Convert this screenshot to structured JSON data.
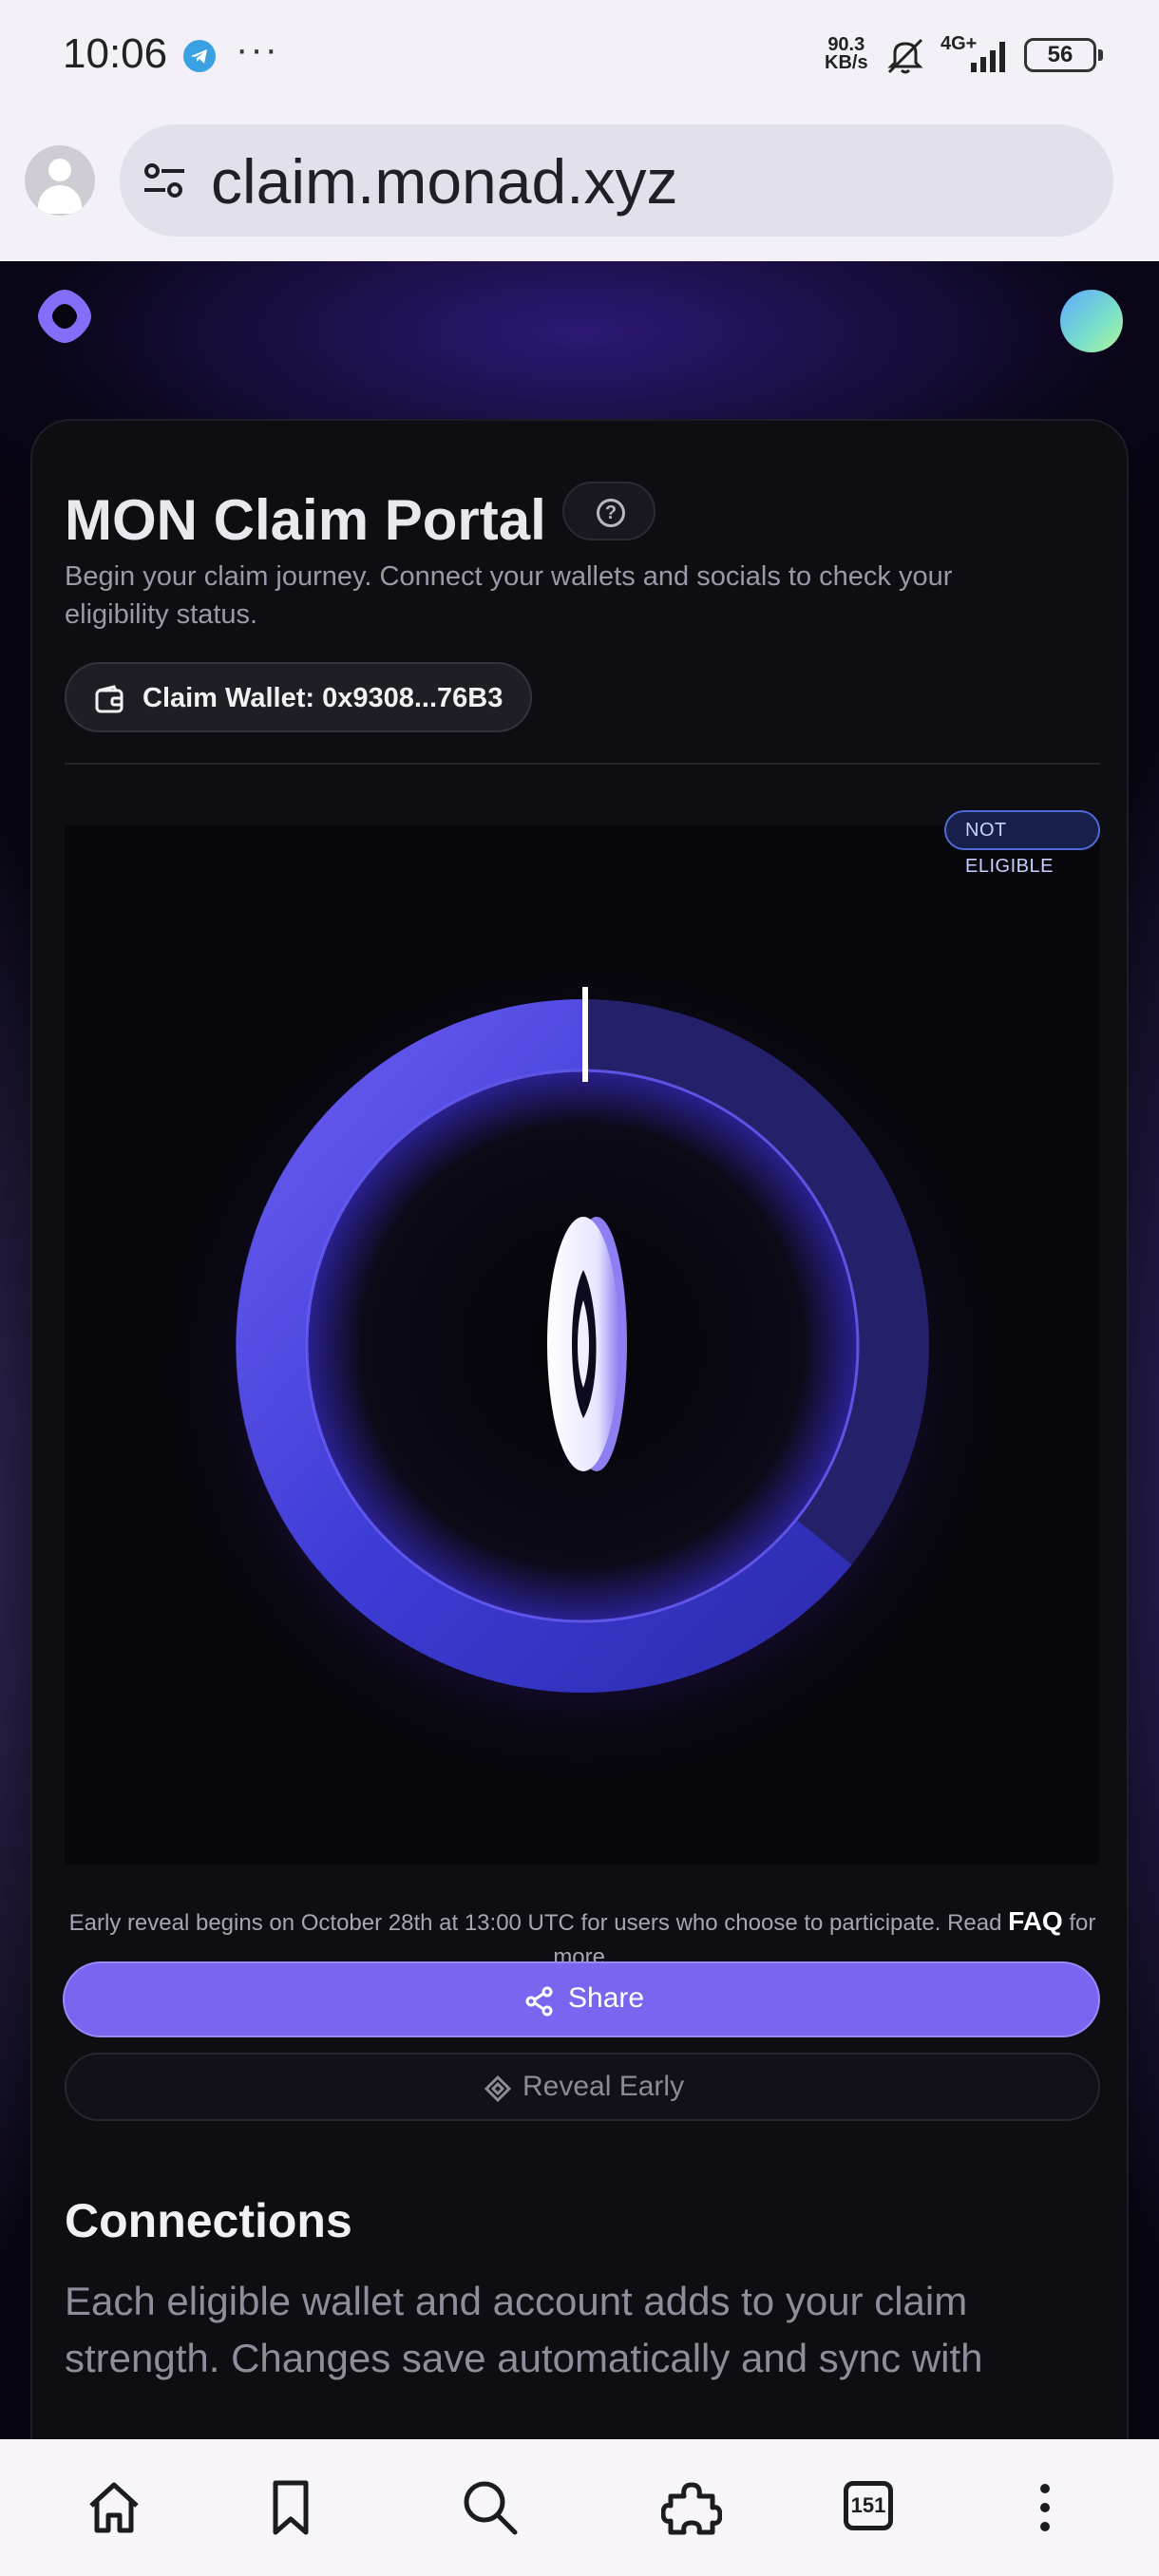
{
  "status_bar": {
    "time": "10:06",
    "dots": "···",
    "net_speed_value": "90.3",
    "net_speed_unit": "KB/s",
    "network_type": "4G+",
    "battery": "56",
    "icons": [
      "telegram-icon",
      "mute-icon",
      "signal-icon",
      "battery-icon"
    ]
  },
  "browser": {
    "url": "claim.monad.xyz",
    "tab_count": "151",
    "nav_icons": [
      "home-icon",
      "bookmark-icon",
      "search-icon",
      "extensions-icon",
      "tabs-icon",
      "more-icon"
    ]
  },
  "page": {
    "title": "MON Claim Portal",
    "help_icon": "question-icon",
    "subtitle": "Begin your claim journey. Connect your wallets and socials to check your eligibility status.",
    "wallet_label": "Claim Wallet: 0x9308...76B3",
    "status_badge": "NOT ELIGIBLE",
    "reveal_info_prefix": "Early reveal begins on October 28th at 13:00 UTC for users who choose to participate. Read",
    "faq_link": "FAQ",
    "reveal_info_suffix": "for more.",
    "share_label": "Share",
    "reveal_early_label": "Reveal Early",
    "connections_title": "Connections",
    "connections_desc": "Each eligible wallet and account adds to your claim strength. Changes save automatically and sync with"
  },
  "colors": {
    "accent": "#7866f0",
    "background": "#07050f",
    "badge_border": "#4d6ad6"
  }
}
